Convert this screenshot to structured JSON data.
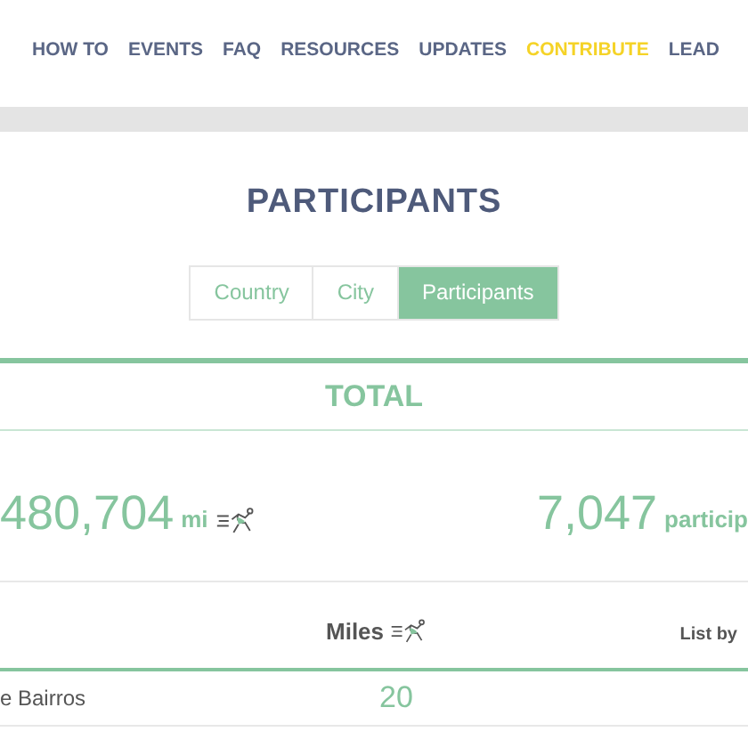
{
  "nav": [
    {
      "label": "HOW TO",
      "highlighted": false
    },
    {
      "label": "EVENTS",
      "highlighted": false
    },
    {
      "label": "FAQ",
      "highlighted": false
    },
    {
      "label": "RESOURCES",
      "highlighted": false
    },
    {
      "label": "UPDATES",
      "highlighted": false
    },
    {
      "label": "CONTRIBUTE",
      "highlighted": true
    },
    {
      "label": "LEAD",
      "highlighted": false
    }
  ],
  "heading": "PARTICIPANTS",
  "tabs": [
    {
      "label": "Country",
      "selected": false
    },
    {
      "label": "City",
      "selected": false
    },
    {
      "label": "Participants",
      "selected": true
    }
  ],
  "total": {
    "title": "TOTAL",
    "miles": "480,704",
    "miles_unit": "mi",
    "participants": "7,047",
    "participants_unit": "particip"
  },
  "table": {
    "miles_header": "Miles",
    "list_by": "List by",
    "rows": [
      {
        "name": "e Bairros",
        "miles": "20"
      }
    ]
  }
}
